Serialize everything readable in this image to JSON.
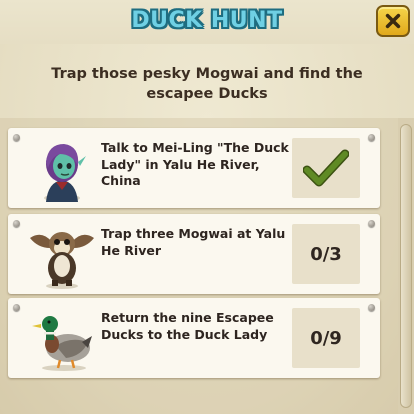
{
  "title": "DUCK HUNT",
  "subtitle": "Trap those pesky Mogwai and find the escapee Ducks",
  "tasks": [
    {
      "text": "Talk to Mei-Ling \"The Duck Lady\" in Yalu He River, China",
      "status": "complete",
      "status_icon": "checkmark-icon"
    },
    {
      "text": "Trap three Mogwai at Yalu He River",
      "status": "0/3"
    },
    {
      "text": "Return the nine Escapee Ducks to the Duck Lady",
      "status": "0/9"
    }
  ],
  "colors": {
    "title_fill": "#6fd0e4",
    "title_outline": "#1e6d80",
    "check_green": "#5a7d1e",
    "close_button": "#f0c531"
  },
  "icons": {
    "close": "close-x-icon",
    "task1_avatar": "mei-ling-avatar",
    "task2_avatar": "mogwai-avatar",
    "task3_avatar": "duck-avatar"
  }
}
